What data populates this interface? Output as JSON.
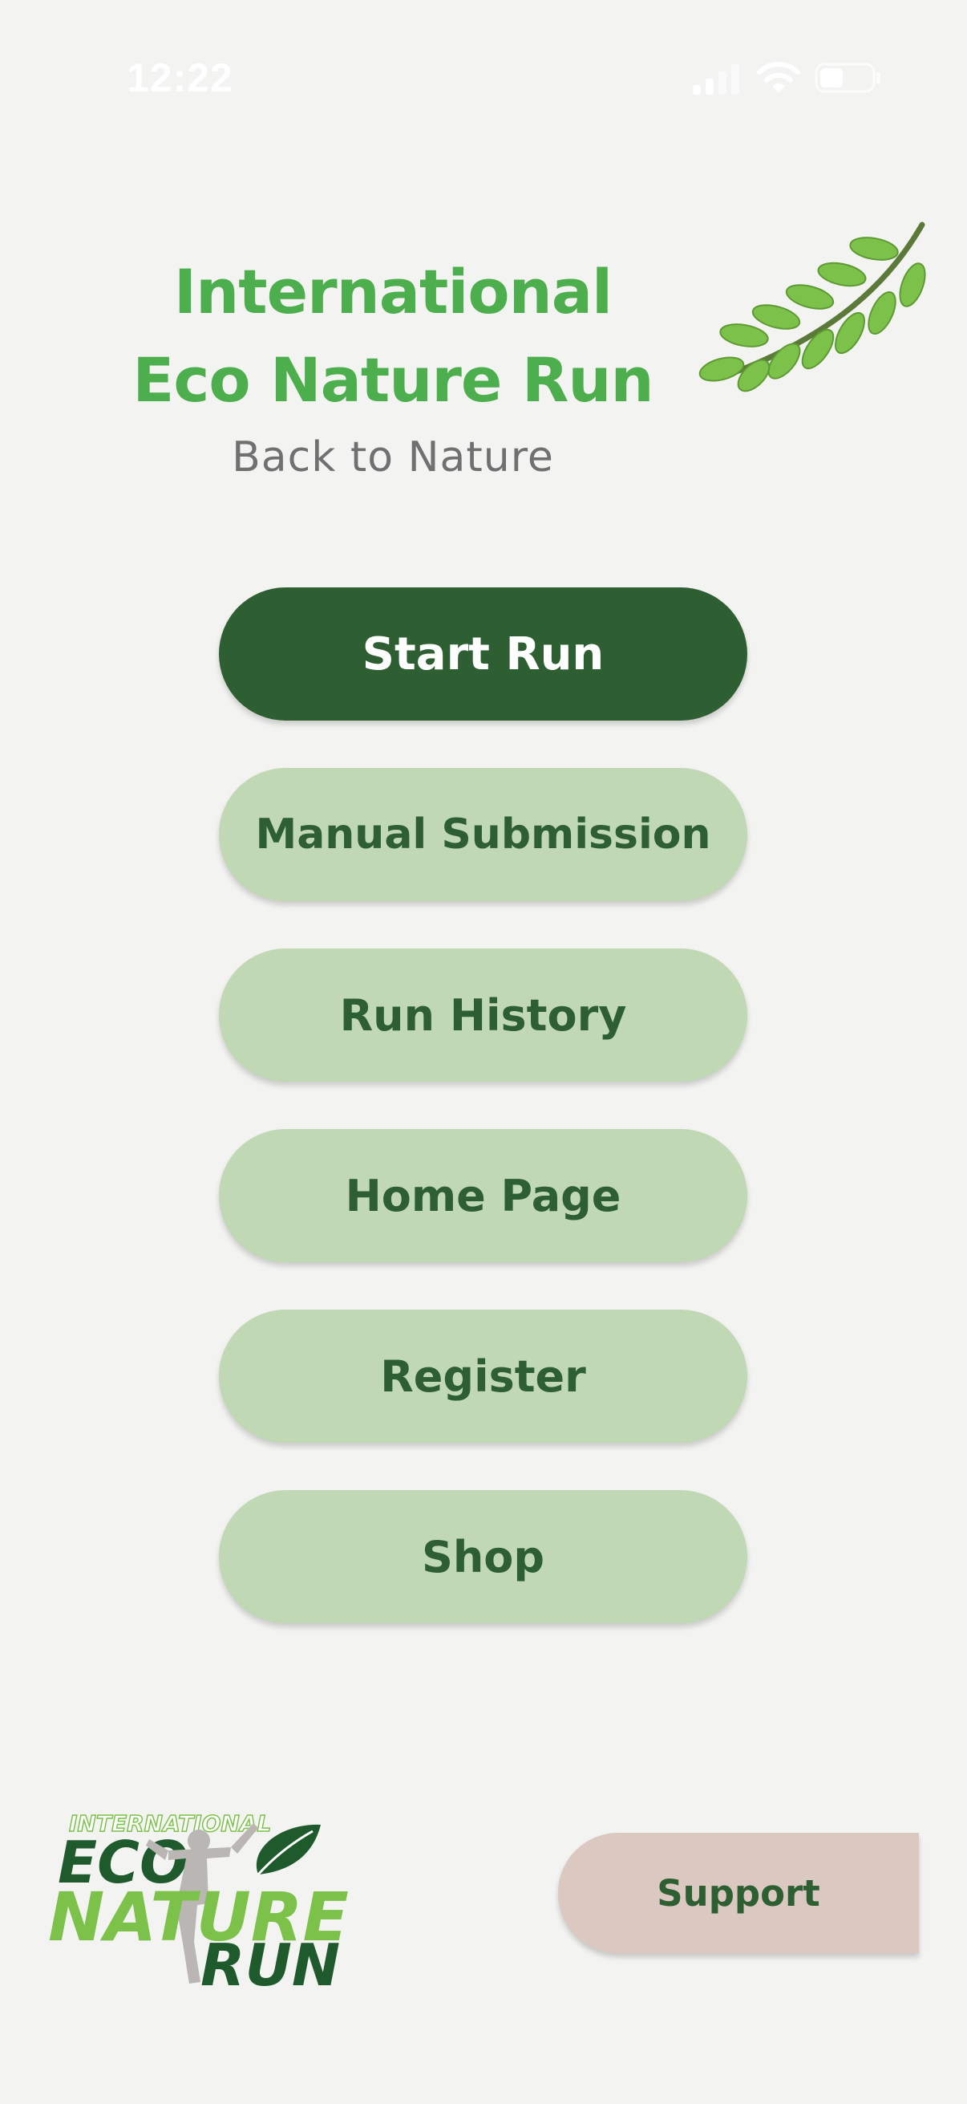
{
  "status_bar": {
    "time": "12:22",
    "icons": [
      "signal-icon",
      "wifi-icon",
      "battery-icon"
    ]
  },
  "header": {
    "title_line1": "International",
    "title_line2": "Eco Nature Run",
    "subtitle": "Back to Nature",
    "decoration": "leaf-branch-icon"
  },
  "menu": {
    "start_run": "Start Run",
    "manual_submission": "Manual Submission",
    "run_history": "Run History",
    "home_page": "Home Page",
    "register": "Register",
    "shop": "Shop"
  },
  "footer": {
    "logo": {
      "line1": "INTERNATIONAL",
      "line2": "ECO",
      "line3": "NATURE",
      "line4": "RUN"
    },
    "support": "Support"
  },
  "colors": {
    "background": "#f3f3f2",
    "title_green": "#4cae4c",
    "primary_button": "#2e5f33",
    "secondary_button": "#c1d8b5",
    "support_button": "#dac8c1",
    "subtitle_gray": "#707070"
  }
}
